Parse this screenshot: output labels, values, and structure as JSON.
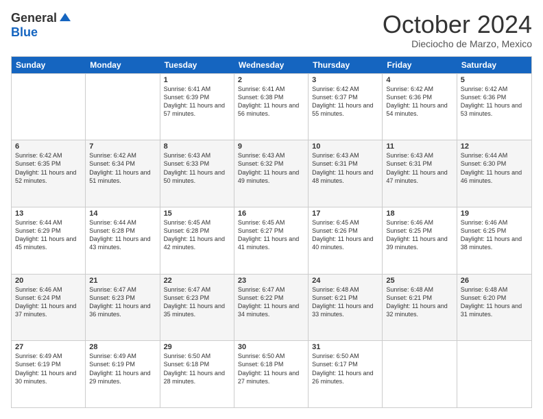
{
  "header": {
    "logo_general": "General",
    "logo_blue": "Blue",
    "month_title": "October 2024",
    "location": "Dieciocho de Marzo, Mexico"
  },
  "weekdays": [
    "Sunday",
    "Monday",
    "Tuesday",
    "Wednesday",
    "Thursday",
    "Friday",
    "Saturday"
  ],
  "weeks": [
    [
      {
        "day": "",
        "sunrise": "",
        "sunset": "",
        "daylight": "",
        "shaded": false
      },
      {
        "day": "",
        "sunrise": "",
        "sunset": "",
        "daylight": "",
        "shaded": false
      },
      {
        "day": "1",
        "sunrise": "Sunrise: 6:41 AM",
        "sunset": "Sunset: 6:39 PM",
        "daylight": "Daylight: 11 hours and 57 minutes.",
        "shaded": false
      },
      {
        "day": "2",
        "sunrise": "Sunrise: 6:41 AM",
        "sunset": "Sunset: 6:38 PM",
        "daylight": "Daylight: 11 hours and 56 minutes.",
        "shaded": false
      },
      {
        "day": "3",
        "sunrise": "Sunrise: 6:42 AM",
        "sunset": "Sunset: 6:37 PM",
        "daylight": "Daylight: 11 hours and 55 minutes.",
        "shaded": false
      },
      {
        "day": "4",
        "sunrise": "Sunrise: 6:42 AM",
        "sunset": "Sunset: 6:36 PM",
        "daylight": "Daylight: 11 hours and 54 minutes.",
        "shaded": false
      },
      {
        "day": "5",
        "sunrise": "Sunrise: 6:42 AM",
        "sunset": "Sunset: 6:36 PM",
        "daylight": "Daylight: 11 hours and 53 minutes.",
        "shaded": false
      }
    ],
    [
      {
        "day": "6",
        "sunrise": "Sunrise: 6:42 AM",
        "sunset": "Sunset: 6:35 PM",
        "daylight": "Daylight: 11 hours and 52 minutes.",
        "shaded": true
      },
      {
        "day": "7",
        "sunrise": "Sunrise: 6:42 AM",
        "sunset": "Sunset: 6:34 PM",
        "daylight": "Daylight: 11 hours and 51 minutes.",
        "shaded": true
      },
      {
        "day": "8",
        "sunrise": "Sunrise: 6:43 AM",
        "sunset": "Sunset: 6:33 PM",
        "daylight": "Daylight: 11 hours and 50 minutes.",
        "shaded": true
      },
      {
        "day": "9",
        "sunrise": "Sunrise: 6:43 AM",
        "sunset": "Sunset: 6:32 PM",
        "daylight": "Daylight: 11 hours and 49 minutes.",
        "shaded": true
      },
      {
        "day": "10",
        "sunrise": "Sunrise: 6:43 AM",
        "sunset": "Sunset: 6:31 PM",
        "daylight": "Daylight: 11 hours and 48 minutes.",
        "shaded": true
      },
      {
        "day": "11",
        "sunrise": "Sunrise: 6:43 AM",
        "sunset": "Sunset: 6:31 PM",
        "daylight": "Daylight: 11 hours and 47 minutes.",
        "shaded": true
      },
      {
        "day": "12",
        "sunrise": "Sunrise: 6:44 AM",
        "sunset": "Sunset: 6:30 PM",
        "daylight": "Daylight: 11 hours and 46 minutes.",
        "shaded": true
      }
    ],
    [
      {
        "day": "13",
        "sunrise": "Sunrise: 6:44 AM",
        "sunset": "Sunset: 6:29 PM",
        "daylight": "Daylight: 11 hours and 45 minutes.",
        "shaded": false
      },
      {
        "day": "14",
        "sunrise": "Sunrise: 6:44 AM",
        "sunset": "Sunset: 6:28 PM",
        "daylight": "Daylight: 11 hours and 43 minutes.",
        "shaded": false
      },
      {
        "day": "15",
        "sunrise": "Sunrise: 6:45 AM",
        "sunset": "Sunset: 6:28 PM",
        "daylight": "Daylight: 11 hours and 42 minutes.",
        "shaded": false
      },
      {
        "day": "16",
        "sunrise": "Sunrise: 6:45 AM",
        "sunset": "Sunset: 6:27 PM",
        "daylight": "Daylight: 11 hours and 41 minutes.",
        "shaded": false
      },
      {
        "day": "17",
        "sunrise": "Sunrise: 6:45 AM",
        "sunset": "Sunset: 6:26 PM",
        "daylight": "Daylight: 11 hours and 40 minutes.",
        "shaded": false
      },
      {
        "day": "18",
        "sunrise": "Sunrise: 6:46 AM",
        "sunset": "Sunset: 6:25 PM",
        "daylight": "Daylight: 11 hours and 39 minutes.",
        "shaded": false
      },
      {
        "day": "19",
        "sunrise": "Sunrise: 6:46 AM",
        "sunset": "Sunset: 6:25 PM",
        "daylight": "Daylight: 11 hours and 38 minutes.",
        "shaded": false
      }
    ],
    [
      {
        "day": "20",
        "sunrise": "Sunrise: 6:46 AM",
        "sunset": "Sunset: 6:24 PM",
        "daylight": "Daylight: 11 hours and 37 minutes.",
        "shaded": true
      },
      {
        "day": "21",
        "sunrise": "Sunrise: 6:47 AM",
        "sunset": "Sunset: 6:23 PM",
        "daylight": "Daylight: 11 hours and 36 minutes.",
        "shaded": true
      },
      {
        "day": "22",
        "sunrise": "Sunrise: 6:47 AM",
        "sunset": "Sunset: 6:23 PM",
        "daylight": "Daylight: 11 hours and 35 minutes.",
        "shaded": true
      },
      {
        "day": "23",
        "sunrise": "Sunrise: 6:47 AM",
        "sunset": "Sunset: 6:22 PM",
        "daylight": "Daylight: 11 hours and 34 minutes.",
        "shaded": true
      },
      {
        "day": "24",
        "sunrise": "Sunrise: 6:48 AM",
        "sunset": "Sunset: 6:21 PM",
        "daylight": "Daylight: 11 hours and 33 minutes.",
        "shaded": true
      },
      {
        "day": "25",
        "sunrise": "Sunrise: 6:48 AM",
        "sunset": "Sunset: 6:21 PM",
        "daylight": "Daylight: 11 hours and 32 minutes.",
        "shaded": true
      },
      {
        "day": "26",
        "sunrise": "Sunrise: 6:48 AM",
        "sunset": "Sunset: 6:20 PM",
        "daylight": "Daylight: 11 hours and 31 minutes.",
        "shaded": true
      }
    ],
    [
      {
        "day": "27",
        "sunrise": "Sunrise: 6:49 AM",
        "sunset": "Sunset: 6:19 PM",
        "daylight": "Daylight: 11 hours and 30 minutes.",
        "shaded": false
      },
      {
        "day": "28",
        "sunrise": "Sunrise: 6:49 AM",
        "sunset": "Sunset: 6:19 PM",
        "daylight": "Daylight: 11 hours and 29 minutes.",
        "shaded": false
      },
      {
        "day": "29",
        "sunrise": "Sunrise: 6:50 AM",
        "sunset": "Sunset: 6:18 PM",
        "daylight": "Daylight: 11 hours and 28 minutes.",
        "shaded": false
      },
      {
        "day": "30",
        "sunrise": "Sunrise: 6:50 AM",
        "sunset": "Sunset: 6:18 PM",
        "daylight": "Daylight: 11 hours and 27 minutes.",
        "shaded": false
      },
      {
        "day": "31",
        "sunrise": "Sunrise: 6:50 AM",
        "sunset": "Sunset: 6:17 PM",
        "daylight": "Daylight: 11 hours and 26 minutes.",
        "shaded": false
      },
      {
        "day": "",
        "sunrise": "",
        "sunset": "",
        "daylight": "",
        "shaded": false
      },
      {
        "day": "",
        "sunrise": "",
        "sunset": "",
        "daylight": "",
        "shaded": false
      }
    ]
  ]
}
